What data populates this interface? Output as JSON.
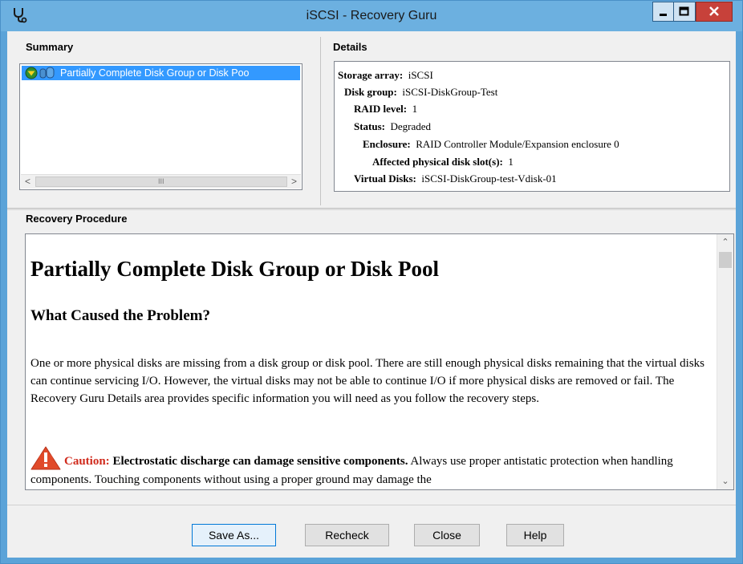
{
  "window": {
    "title": "iSCSI - Recovery Guru",
    "icons": {
      "app": "stethoscope-icon",
      "minimize": "minimize-icon",
      "maximize": "maximize-icon",
      "close": "close-icon"
    },
    "colors": {
      "titlebar": "#6cb0e0",
      "close_button": "#c7413a",
      "selection": "#3399ff",
      "caution": "#d02a1c"
    }
  },
  "summary": {
    "label": "Summary",
    "items": [
      {
        "label": "Partially Complete Disk Group or Disk Poo",
        "icons": [
          "degraded-status-icon",
          "disk-group-icon"
        ],
        "selected": true
      }
    ],
    "scroll_grip": "III"
  },
  "details": {
    "label": "Details",
    "rows": [
      {
        "key": "Storage array:",
        "value": "iSCSI"
      },
      {
        "key": "Disk group:",
        "value": "iSCSI-DiskGroup-Test"
      },
      {
        "key": "RAID level:",
        "value": "1"
      },
      {
        "key": "Status:",
        "value": "Degraded"
      },
      {
        "key": "Enclosure:",
        "value": "RAID Controller Module/Expansion enclosure 0"
      },
      {
        "key": "Affected physical disk slot(s):",
        "value": "1"
      },
      {
        "key": "Virtual Disks:",
        "value": "iSCSI-DiskGroup-test-Vdisk-01"
      }
    ]
  },
  "procedure": {
    "label": "Recovery Procedure",
    "title": "Partially Complete Disk Group or Disk Pool",
    "subtitle": "What Caused the Problem?",
    "paragraph": "One or more physical disks are missing from a disk group or disk pool. There are still enough physical disks remaining that the virtual disks can continue servicing I/O. However, the virtual disks may not be able to continue I/O if more physical disks are removed or fail. The Recovery Guru Details area provides specific information you will need as you follow the recovery steps.",
    "caution": {
      "icon": "warning-icon",
      "label": "Caution:",
      "bold_text": "Electrostatic discharge can damage sensitive components.",
      "text": "Always use proper antistatic protection when handling components. Touching components without using a proper ground may damage the"
    }
  },
  "buttons": {
    "save_as": "Save As...",
    "recheck": "Recheck",
    "close": "Close",
    "help": "Help"
  }
}
